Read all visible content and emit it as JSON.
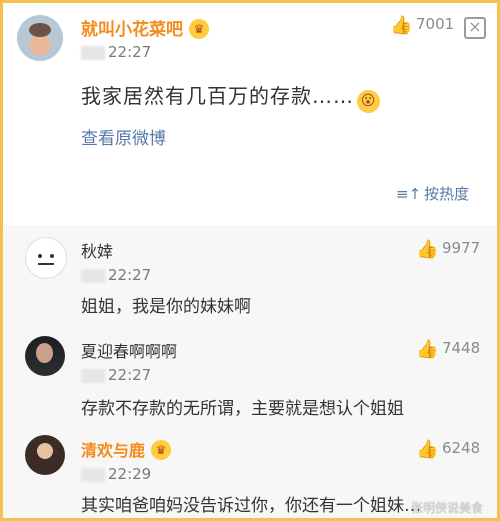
{
  "post": {
    "author": "就叫小花菜吧",
    "crown": "♛",
    "time": "22:27",
    "text": "我家居然有几百万的存款……",
    "emoji": "😮",
    "view_original": "查看原微博",
    "likes": "7001",
    "sort_label": "按热度",
    "sort_icon": "≡↑",
    "more_icon": "×"
  },
  "comments": [
    {
      "author": "秋婞",
      "time": "22:27",
      "likes": "9977",
      "text": "姐姐，我是你的妹妹啊"
    },
    {
      "author": "夏迎春啊啊啊",
      "time": "22:27",
      "likes": "7448",
      "text": "存款不存款的无所谓，主要就是想认个姐姐"
    },
    {
      "author": "清欢与鹿",
      "time": "22:29",
      "likes": "6248",
      "text": "其实咱爸咱妈没告诉过你，你还有一个姐妹…",
      "crown": "♛"
    }
  ],
  "watermark": "张明侠说美食",
  "icons": {
    "thumb": "👍"
  },
  "colors": {
    "accent": "#f28c1b",
    "link": "#5779a8",
    "border": "#f2c14e"
  }
}
